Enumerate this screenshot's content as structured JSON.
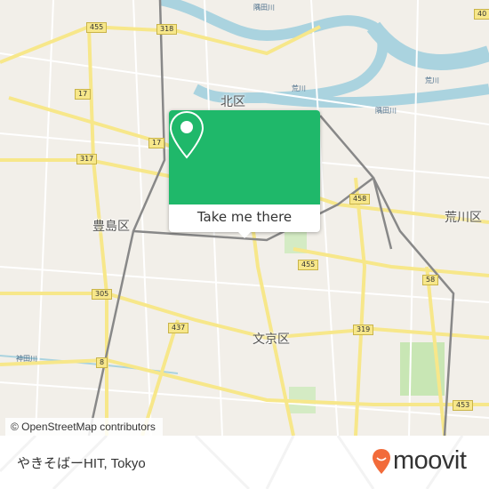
{
  "map": {
    "districts": [
      "北区",
      "豊島区",
      "荒川区",
      "文京区"
    ],
    "rivers": [
      "隅田川",
      "荒川",
      "隅田川",
      "神田川",
      "荒川"
    ],
    "route_shields": [
      "455",
      "318",
      "40",
      "17",
      "17",
      "317",
      "458",
      "455",
      "58",
      "305",
      "437",
      "319",
      "8",
      "453"
    ],
    "attribution": "© OpenStreetMap contributors",
    "colors": {
      "land": "#f2efe9",
      "water": "#aad3df",
      "major_road": "#f7e78a",
      "rail": "#888888"
    }
  },
  "popup": {
    "icon": "map-pin-icon",
    "cta_label": "Take me there",
    "color": "#1fb86a"
  },
  "footer": {
    "place_name": "やきそばーHIT, Tokyo",
    "brand": "moovit",
    "brand_color": "#f26b3a"
  }
}
